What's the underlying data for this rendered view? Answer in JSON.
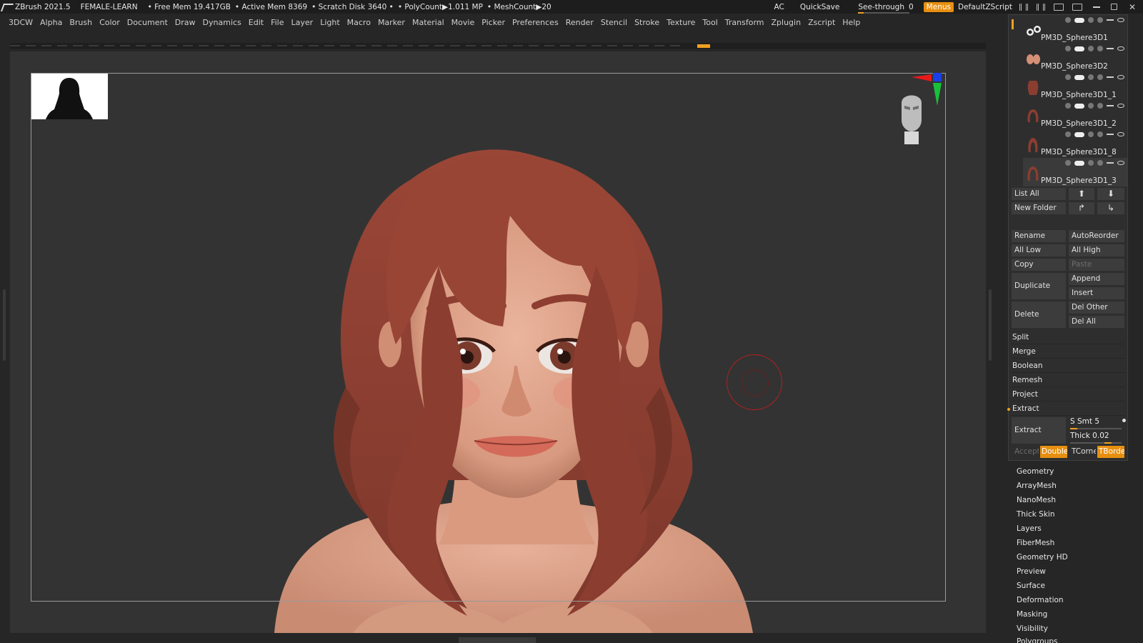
{
  "titlebar": {
    "app": "ZBrush 2021.5",
    "document": "FEMALE-LEARN",
    "free_mem": "• Free Mem 19.417GB",
    "active_mem": "• Active Mem 8369",
    "scratch": "• Scratch Disk 3640 •",
    "polycount": "• PolyCount▶1.011 MP",
    "meshcount": "• MeshCount▶20",
    "ac": "AC",
    "quicksave": "QuickSave",
    "seethrough": "See-through",
    "seethrough_value": "0",
    "menus": "Menus",
    "script": "DefaultZScript"
  },
  "menu": [
    "3DCW",
    "Alpha",
    "Brush",
    "Color",
    "Document",
    "Draw",
    "Dynamics",
    "Edit",
    "File",
    "Layer",
    "Light",
    "Macro",
    "Marker",
    "Material",
    "Movie",
    "Picker",
    "Preferences",
    "Render",
    "Stencil",
    "Stroke",
    "Texture",
    "Tool",
    "Transform",
    "Zplugin",
    "Zscript",
    "Help"
  ],
  "subtools": [
    {
      "name": "PM3D_Sphere3D1"
    },
    {
      "name": "PM3D_Sphere3D2"
    },
    {
      "name": "PM3D_Sphere3D1_1"
    },
    {
      "name": "PM3D_Sphere3D1_2"
    },
    {
      "name": "PM3D_Sphere3D1_8"
    },
    {
      "name": "PM3D_Sphere3D1_3"
    }
  ],
  "subtool_buttons": {
    "list_all": "List All",
    "new_folder": "New Folder",
    "rename": "Rename",
    "autoreorder": "AutoReorder",
    "all_low": "All Low",
    "all_high": "All High",
    "copy": "Copy",
    "paste": "Paste",
    "duplicate": "Duplicate",
    "append": "Append",
    "insert": "Insert",
    "delete": "Delete",
    "del_other": "Del Other",
    "del_all": "Del All"
  },
  "sections": [
    "Split",
    "Merge",
    "Boolean",
    "Remesh",
    "Project",
    "Extract"
  ],
  "extract": {
    "extract_btn": "Extract",
    "s_smt": "S Smt 5",
    "s_smt_value": 5,
    "thick": "Thick 0.02",
    "thick_value": 0.02,
    "accept": "Accept",
    "double": "Double",
    "tcorne": "TCorne",
    "tborde": "TBorde"
  },
  "palettes": [
    "Geometry",
    "ArrayMesh",
    "NanoMesh",
    "Thick Skin",
    "Layers",
    "FiberMesh",
    "Geometry HD",
    "Preview",
    "Surface",
    "Deformation",
    "Masking",
    "Visibility",
    "Polygroups"
  ],
  "colors": {
    "accent": "#e88f10",
    "hair": "#8e3e30",
    "skin": "#d99578",
    "viewport": "#333333"
  }
}
